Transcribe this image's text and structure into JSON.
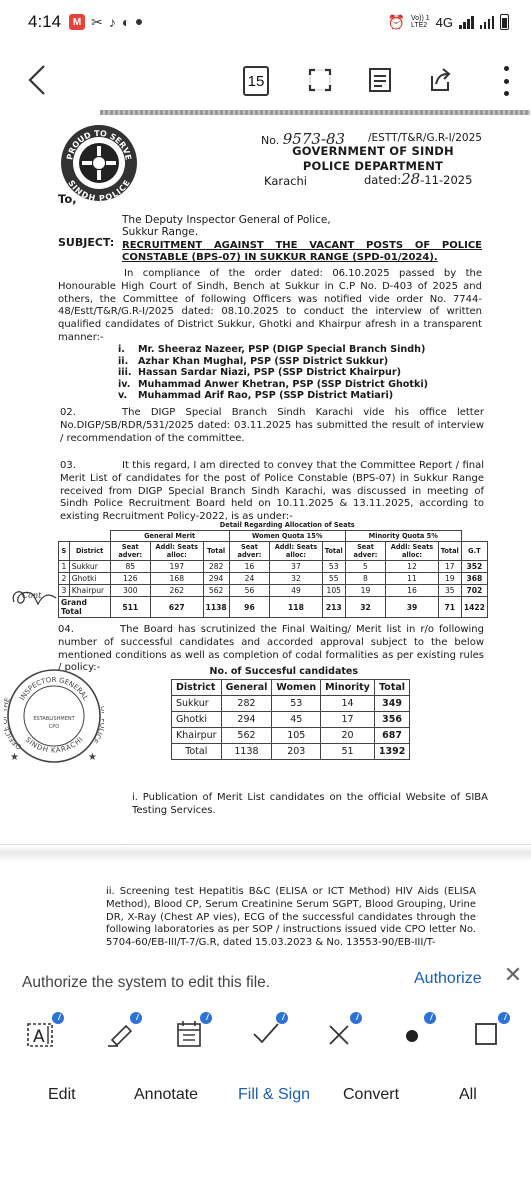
{
  "status_bar": {
    "time": "4:14",
    "volte": "Vo)) 1\nLTE2",
    "network": "4G"
  },
  "toolbar": {
    "page_number": "15"
  },
  "document": {
    "no_label": "No.",
    "no_handwritten": "9573-83",
    "reference": "/ESTT/T&R/G.R-I/2025",
    "government": "GOVERNMENT OF SINDH",
    "department": "POLICE DEPARTMENT",
    "city": "Karachi",
    "dated_label": "dated:",
    "dated_handwritten": "28",
    "dated_suffix": "-11-2025",
    "to_label": "To,",
    "addressee_line1": "The Deputy Inspector General of Police,",
    "addressee_line2": "Sukkur Range.",
    "subject_label": "SUBJECT:",
    "subject_text": "RECRUITMENT AGAINST THE VACANT POSTS OF POLICE CONSTABLE (BPS-07) IN SUKKUR RANGE (SPD-01/2024).",
    "para_intro": "In compliance of the order dated: 06.10.2025 passed by the Honourable High Court of Sindh, Bench at Sukkur in C.P No. D-403 of 2025 and others, the Committee of following Officers was notified vide order No. 7744-48/Estt/T&R/G.R-I/2025 dated: 08.10.2025 to conduct the interview of written qualified candidates of District Sukkur, Ghotki and Khairpur afresh in a transparent manner:-",
    "officers": [
      {
        "num": "i.",
        "name": "Mr. Sheeraz Nazeer, PSP (DIGP Special Branch Sindh)"
      },
      {
        "num": "ii.",
        "name": "Azhar Khan Mughal, PSP (SSP District Sukkur)"
      },
      {
        "num": "iii.",
        "name": "Hassan Sardar Niazi, PSP (SSP District Khairpur)"
      },
      {
        "num": "iv.",
        "name": "Muhammad Anwer Khetran, PSP (SSP District Ghotki)"
      },
      {
        "num": "v.",
        "name": "Muhammad Arif Rao, PSP (SSP District Matiari)"
      }
    ],
    "para_02_num": "02.",
    "para_02": "The DIGP Special Branch Sindh Karachi vide his office letter No.DIGP/SB/RDR/531/2025 dated: 03.11.2025 has submitted the result of interview / recommendation of the committee.",
    "para_03_num": "03.",
    "para_03": "It this regard, I am directed to convey that the Committee Report / final Merit List of candidates for the post of Police Constable (BPS-07) in Sukkur Range received from DIGP Special Branch Sindh Karachi, was discussed in meeting of Sindh Police Recruitment Board held on 10.11.2025 & 13.11.2025, according to existing Recruitment Policy-2022, is as under:-",
    "para_04_num": "04.",
    "para_04": "The Board has scrutinized the Final Waiting/ Merit list in r/o following number of successful candidates and accorded approval subject to the below mentioned conditions as well as completion of codal formalities as per existing rules / policy:-",
    "condition_i": "i.   Publication of Merit List candidates on the official Website of SIBA Testing Services.",
    "condition_ii": "ii. Screening test Hepatitis B&C (ELISA or ICT Method) HIV Aids (ELISA Method), Blood CP, Serum Creatinine Serum SGPT, Blood Grouping, Urine DR, X-Ray (Chest AP vies), ECG of the successful candidates through the following laboratories as per SOP / instructions issued vide CPO letter No. 5704-60/EB-III/T-7/G.R, dated 15.03.2023 & No. 13553-90/EB-III/T-",
    "margin_annotation": "Cont.",
    "seal_text_top": "INSPECTOR GENERAL",
    "seal_text_left": "OFFICE OF THE",
    "seal_text_right": "OF POLICE",
    "seal_text_bottom": "SINDH KARACHI",
    "seal_center_1": "ESTABLISHMENT",
    "seal_center_2": "CPO",
    "logo_text_top": "PROUD TO SERVE",
    "logo_text_bottom": "SINDH POLICE"
  },
  "seats_table": {
    "caption": "Detail Regarding Allocation of Seats",
    "groups": [
      "General Merit",
      "Women Quota 15%",
      "Minority Quota 5%"
    ],
    "headers": {
      "s": "S",
      "district": "District",
      "seat_adver": "Seat adver:",
      "addl": "Addl: Seats alloc:",
      "total": "Total",
      "gt": "G.T"
    },
    "rows": [
      {
        "s": "1",
        "district": "Sukkur",
        "gm_seat": "85",
        "gm_addl": "197",
        "gm_total": "282",
        "wq_seat": "16",
        "wq_addl": "37",
        "wq_total": "53",
        "mq_seat": "5",
        "mq_addl": "12",
        "mq_total": "17",
        "gt": "352"
      },
      {
        "s": "2",
        "district": "Ghotki",
        "gm_seat": "126",
        "gm_addl": "168",
        "gm_total": "294",
        "wq_seat": "24",
        "wq_addl": "32",
        "wq_total": "55",
        "mq_seat": "8",
        "mq_addl": "11",
        "mq_total": "19",
        "gt": "368"
      },
      {
        "s": "3",
        "district": "Khairpur",
        "gm_seat": "300",
        "gm_addl": "262",
        "gm_total": "562",
        "wq_seat": "56",
        "wq_addl": "49",
        "wq_total": "105",
        "mq_seat": "19",
        "mq_addl": "16",
        "mq_total": "35",
        "gt": "702"
      }
    ],
    "grand_total": {
      "label": "Grand Total",
      "gm_seat": "511",
      "gm_addl": "627",
      "gm_total": "1138",
      "wq_seat": "96",
      "wq_addl": "118",
      "wq_total": "213",
      "mq_seat": "32",
      "mq_addl": "39",
      "mq_total": "71",
      "gt": "1422"
    }
  },
  "success_table": {
    "caption": "No. of Succesful candidates",
    "headers": [
      "District",
      "General",
      "Women",
      "Minority",
      "Total"
    ],
    "rows": [
      [
        "Sukkur",
        "282",
        "53",
        "14",
        "349"
      ],
      [
        "Ghotki",
        "294",
        "45",
        "17",
        "356"
      ],
      [
        "Khairpur",
        "562",
        "105",
        "20",
        "687"
      ],
      [
        "Total",
        "1138",
        "203",
        "51",
        "1392"
      ]
    ]
  },
  "authorize_bar": {
    "message": "Authorize the system to edit this file.",
    "button": "Authorize"
  },
  "bottom_bar": {
    "edit": "Edit",
    "annotate": "Annotate",
    "fill_sign": "Fill & Sign",
    "convert": "Convert",
    "all": "All"
  },
  "colors": {
    "accent_blue": "#1a5fb4",
    "badge_blue": "#2d72d9",
    "app_icon_red": "#e5433a"
  }
}
